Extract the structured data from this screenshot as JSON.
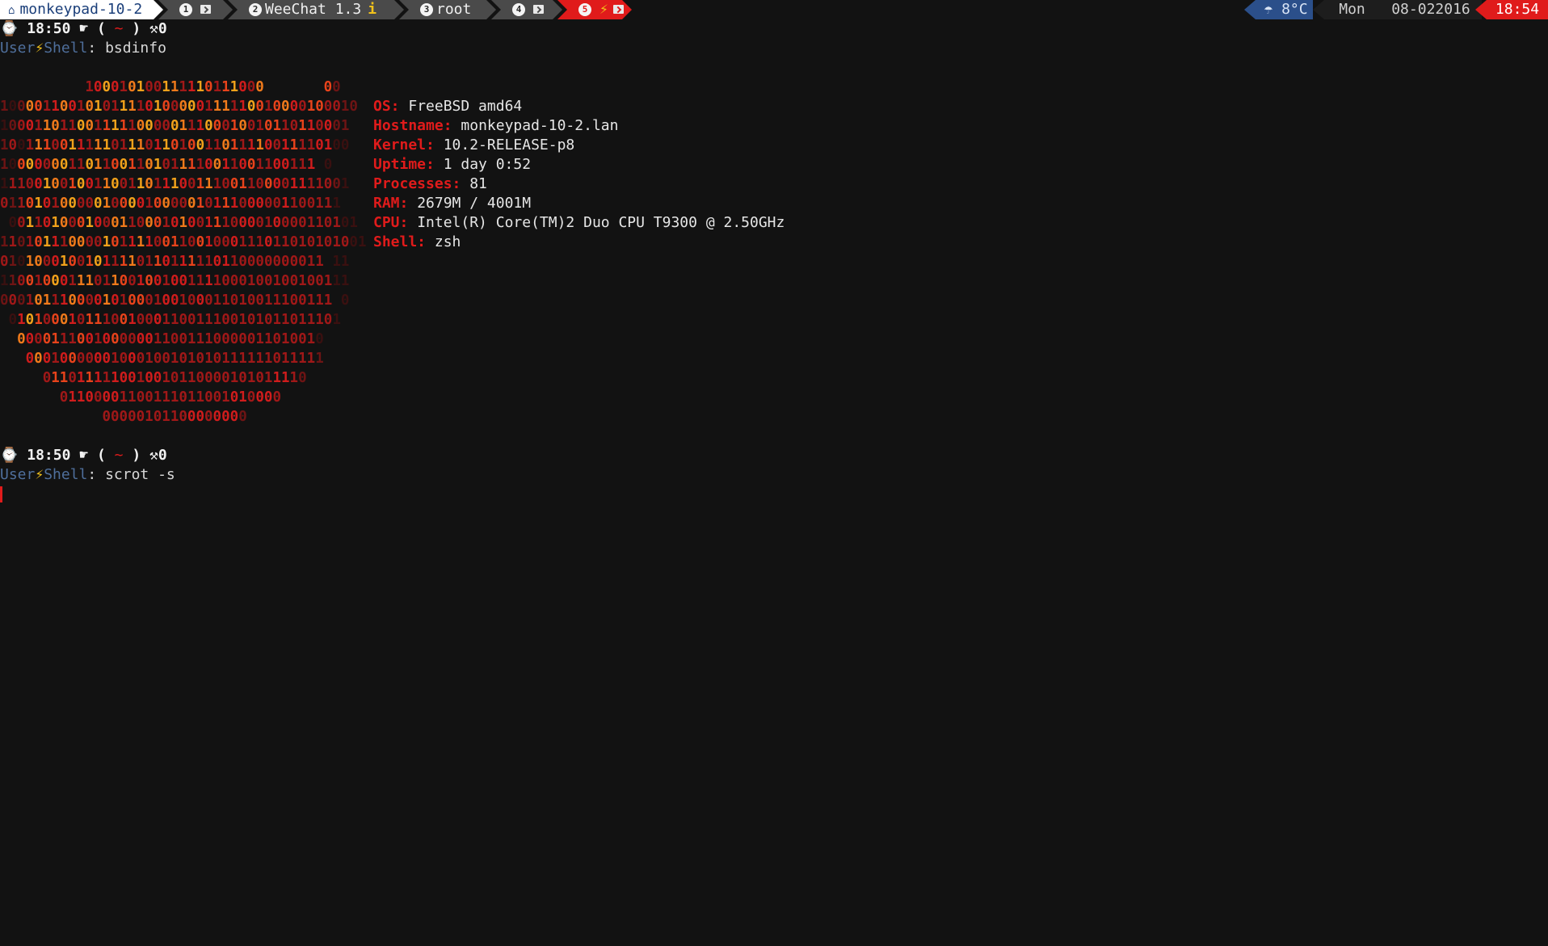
{
  "topbar": {
    "workspaces": [
      {
        "label": "monkeypad-10-2",
        "icon": "home-icon",
        "type": "host"
      },
      {
        "num": "1",
        "icon": "terminal-icon"
      },
      {
        "num": "2",
        "label": "WeeChat 1.3",
        "icon": "info-icon"
      },
      {
        "num": "3",
        "label": "root"
      },
      {
        "num": "4",
        "icon": "terminal-icon"
      },
      {
        "num": "5",
        "icon": "bolt-icon",
        "icon2": "terminal-icon",
        "active": true
      }
    ],
    "weather": "8°C",
    "weather_icon": "umbrella-icon",
    "day": "Mon",
    "date": "08-022016",
    "time": "18:54"
  },
  "prompt1": {
    "clock_icon": "watch-icon",
    "time": "18:50",
    "hand_icon": "pointing-hand-icon",
    "open": "(",
    "dir": "~",
    "close": ")",
    "tools_icon": "tools-icon",
    "count": "0",
    "user": "User",
    "bolt": "⚡",
    "shell": "Shell",
    "sep": ":",
    "cmd": "bsdinfo"
  },
  "ascii_art": [
    "          100010100111110111000       00",
    "100001100101011110100000111110010000100010",
    "10001101100111110000011100010010110110001",
    "10011100111110111011010011011110011110100",
    "1000000011011001101011110011001100111 0",
    "11100100100110011011100111001100001111001",
    "0110101000001000010000010111000001100111",
    " 00110100010001100010100111000010000110101",
    "1101011100001011110011001000111011010101001",
    "01010001001011110110111110110000000011 11",
    "11001000111011001001001111000100100100111",
    "000101110000101000100100011010011100111 0",
    " 010100010111001000110011100101011011101",
    "  000011100100000011001110000011010010",
    "   00010000001000100101010111111011111",
    "     0110111110010010110000101011110",
    "       01100001100111011001010000",
    "            00000101100000000"
  ],
  "sysinfo": [
    {
      "label": "OS:",
      "value": "FreeBSD amd64"
    },
    {
      "label": "Hostname:",
      "value": "monkeypad-10-2.lan"
    },
    {
      "label": "Kernel:",
      "value": "10.2-RELEASE-p8"
    },
    {
      "label": "Uptime:",
      "value": "1 day 0:52"
    },
    {
      "label": "Processes:",
      "value": "81"
    },
    {
      "label": "RAM:",
      "value": "2679M / 4001M"
    },
    {
      "label": "CPU:",
      "value": "Intel(R) Core(TM)2 Duo CPU T9300 @ 2.50GHz"
    },
    {
      "label": "Shell:",
      "value": "zsh"
    }
  ],
  "prompt2": {
    "time": "18:50",
    "open": "(",
    "dir": "~",
    "close": ")",
    "count": "0",
    "user": "User",
    "bolt": "⚡",
    "shell": "Shell",
    "sep": ":",
    "cmd": "scrot -s"
  },
  "colors": {
    "background": "#121212",
    "accent_red": "#e01b1b",
    "accent_blue": "#2b4f8a",
    "prompt_user": "#4f6f9c",
    "bolt_yellow": "#f2c21b"
  }
}
